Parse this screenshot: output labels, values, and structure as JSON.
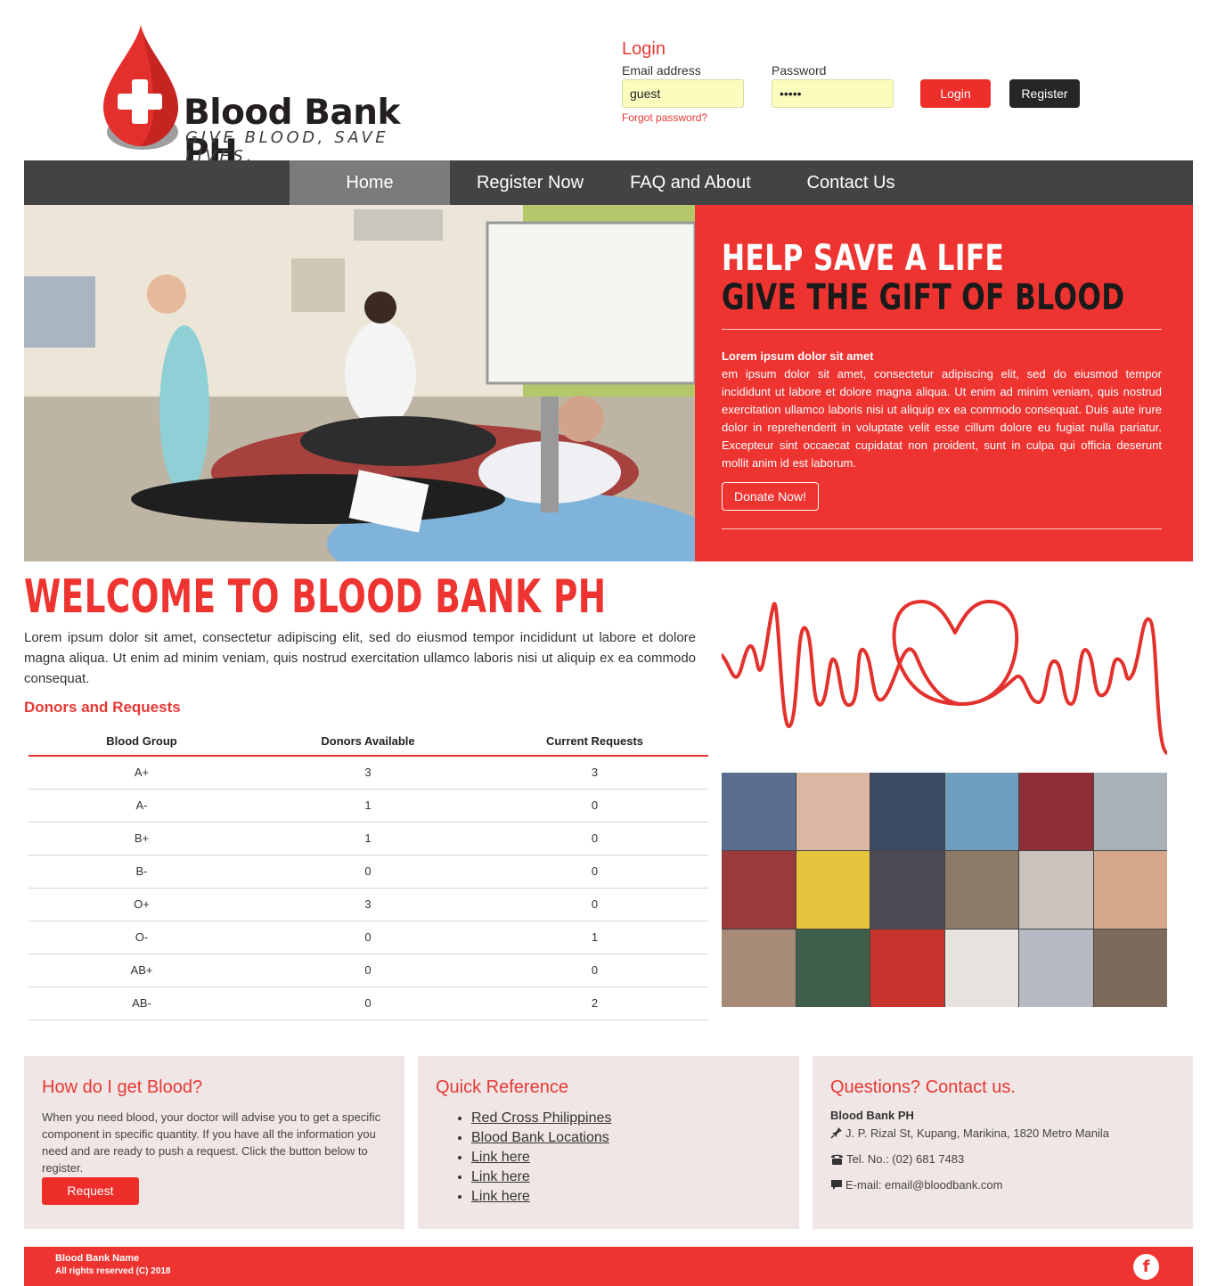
{
  "brand": {
    "name": "Blood Bank PH",
    "tagline": "GIVE BLOOD, SAVE LIVES."
  },
  "login": {
    "title": "Login",
    "email_label": "Email address",
    "email_value": "guest",
    "password_label": "Password",
    "password_value": "•••••",
    "forgot": "Forgot password?",
    "login_button": "Login",
    "register_button": "Register"
  },
  "nav": {
    "items": [
      "Home",
      "Register Now",
      "FAQ and About",
      "Contact Us"
    ],
    "active": "Home"
  },
  "hero": {
    "headline_1": "HELP SAVE A LIFE",
    "headline_2": "GIVE THE GIFT OF BLOOD",
    "subtitle": "Lorem ipsum dolor sit amet",
    "text": "em ipsum dolor sit amet, consectetur adipiscing elit, sed do eiusmod tempor incididunt ut labore et dolore magna aliqua. Ut enim ad minim veniam, quis nostrud exercitation ullamco laboris nisi ut aliquip ex ea commodo consequat. Duis aute irure dolor in reprehenderit in voluptate velit esse cillum dolore eu fugiat nulla pariatur. Excepteur sint occaecat cupidatat non proident, sunt in culpa qui officia deserunt mollit anim id est laborum.",
    "donate_button": "Donate Now!"
  },
  "welcome": {
    "title": "WELCOME TO BLOOD BANK PH",
    "text": "Lorem ipsum dolor sit amet, consectetur adipiscing elit, sed do eiusmod tempor incididunt ut labore et dolore magna aliqua. Ut enim ad minim veniam, quis nostrud exercitation ullamco laboris nisi ut aliquip ex ea commodo consequat."
  },
  "donors": {
    "title": "Donors and Requests",
    "headers": [
      "Blood Group",
      "Donors Available",
      "Current Requests"
    ],
    "rows": [
      [
        "A+",
        "3",
        "3"
      ],
      [
        "A-",
        "1",
        "0"
      ],
      [
        "B+",
        "1",
        "0"
      ],
      [
        "B-",
        "0",
        "0"
      ],
      [
        "O+",
        "3",
        "0"
      ],
      [
        "O-",
        "0",
        "1"
      ],
      [
        "AB+",
        "0",
        "0"
      ],
      [
        "AB-",
        "0",
        "2"
      ]
    ]
  },
  "boxes": {
    "get_blood": {
      "title": "How do I get Blood?",
      "text": "When you need blood, your doctor will advise you to get a specific component in specific quantity. If you have all the information you need and are ready to push a request. Click the button below to register.",
      "button": "Request"
    },
    "quick_ref": {
      "title": "Quick Reference",
      "links": [
        "Red Cross Philippines",
        "Blood Bank Locations",
        "Link here",
        "Link here",
        "Link here"
      ]
    },
    "contact": {
      "title": "Questions? Contact us.",
      "name": "Blood Bank PH",
      "address": "J. P. Rizal St, Kupang, Marikina, 1820 Metro Manila",
      "phone": "Tel. No.: (02) 681 7483",
      "email": "E-mail: email@bloodbank.com"
    }
  },
  "footer": {
    "name": "Blood Bank Name",
    "copyright": "All rights reserved (C) 2018",
    "social_icon": "facebook-icon"
  },
  "colors": {
    "accent": "#ee3431",
    "nav": "#434343",
    "nav_active": "#7b7b7b",
    "input_bg": "#fbfdbd",
    "box_bg": "#f0e6e5"
  }
}
